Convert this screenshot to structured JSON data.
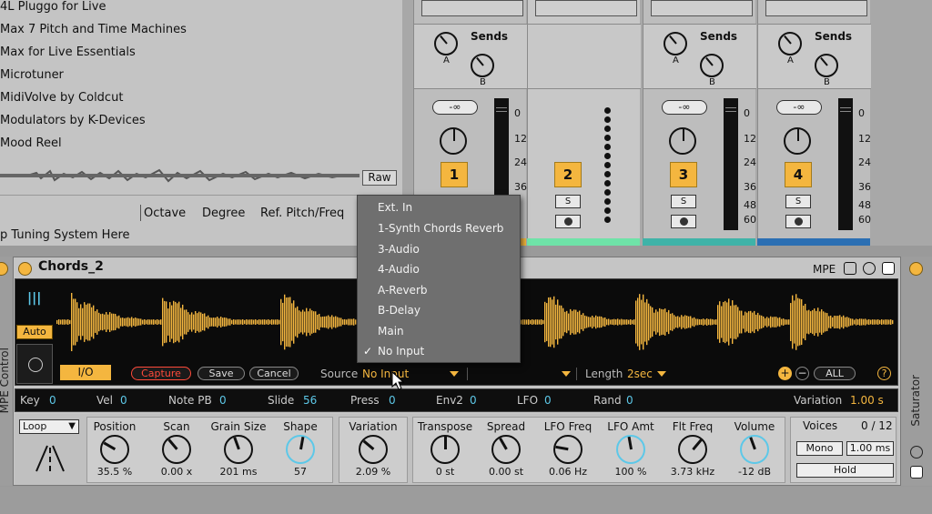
{
  "browser": {
    "items": [
      "4L Pluggo for Live",
      "Max 7 Pitch and Time Machines",
      "Max for Live Essentials",
      "Microtuner",
      "MidiVolve by Coldcut",
      "Modulators by K-Devices",
      "Mood Reel"
    ],
    "raw_label": "Raw"
  },
  "tuning": {
    "headers": [
      "Octave",
      "Degree",
      "Ref. Pitch/Freq"
    ],
    "drop_hint": "p Tuning System Here"
  },
  "mixer": {
    "sends_label": "Sends",
    "send_a": "A",
    "send_b": "B",
    "inf_label": "-∞",
    "scale": [
      "0",
      "12",
      "24",
      "36",
      "48",
      "60"
    ],
    "tracks": [
      {
        "num": "1",
        "solo": "S"
      },
      {
        "num": "2",
        "solo": "S"
      },
      {
        "num": "3",
        "solo": "S"
      },
      {
        "num": "4",
        "solo": "S"
      }
    ],
    "track_colors": [
      "#f4b63f",
      "#6fe3a8",
      "#3fb3a8",
      "#2b6fb3"
    ]
  },
  "device": {
    "title": "Chords_2",
    "mpe_label": "MPE",
    "auto_label": "Auto",
    "io_label": "I/O",
    "capture_label": "Capture",
    "save_label": "Save",
    "cancel_label": "Cancel",
    "source_label": "Source",
    "source_value": "No Input",
    "length_label": "Length",
    "length_value": "2sec",
    "all_label": "ALL",
    "help_label": "?",
    "plus_label": "+",
    "minus_label": "−"
  },
  "params": [
    {
      "label": "Key",
      "value": "0"
    },
    {
      "label": "Vel",
      "value": "0"
    },
    {
      "label": "Note PB",
      "value": "0"
    },
    {
      "label": "Slide",
      "value": "56"
    },
    {
      "label": "Press",
      "value": "0"
    },
    {
      "label": "Env2",
      "value": "0"
    },
    {
      "label": "LFO",
      "value": "0"
    },
    {
      "label": "Rand",
      "value": "0"
    }
  ],
  "variation_rate": {
    "label": "Variation",
    "value": "1.00 s"
  },
  "controls": {
    "loop_mode": "Loop",
    "knobs": [
      {
        "label": "Position",
        "value": "35.5 %"
      },
      {
        "label": "Scan",
        "value": "0.00 x"
      },
      {
        "label": "Grain Size",
        "value": "201 ms"
      },
      {
        "label": "Shape",
        "value": "57"
      },
      {
        "label": "Variation",
        "value": "2.09 %"
      },
      {
        "label": "Transpose",
        "value": "0 st"
      },
      {
        "label": "Spread",
        "value": "0.00 st"
      },
      {
        "label": "LFO Freq",
        "value": "0.06 Hz"
      },
      {
        "label": "LFO Amt",
        "value": "100 %"
      },
      {
        "label": "Flt Freq",
        "value": "3.73 kHz"
      },
      {
        "label": "Volume",
        "value": "-12 dB"
      }
    ],
    "voices_label": "Voices",
    "voices_value": "0 / 12",
    "mono_label": "Mono",
    "glide_value": "1.00 ms",
    "hold_label": "Hold"
  },
  "side": {
    "left_label": "MPE Control",
    "right_label": "Saturator"
  },
  "menu": {
    "items": [
      "Ext. In",
      "1-Synth Chords Reverb",
      "3-Audio",
      "4-Audio",
      "A-Reverb",
      "B-Delay",
      "Main",
      "No Input"
    ],
    "checked": "No Input"
  }
}
